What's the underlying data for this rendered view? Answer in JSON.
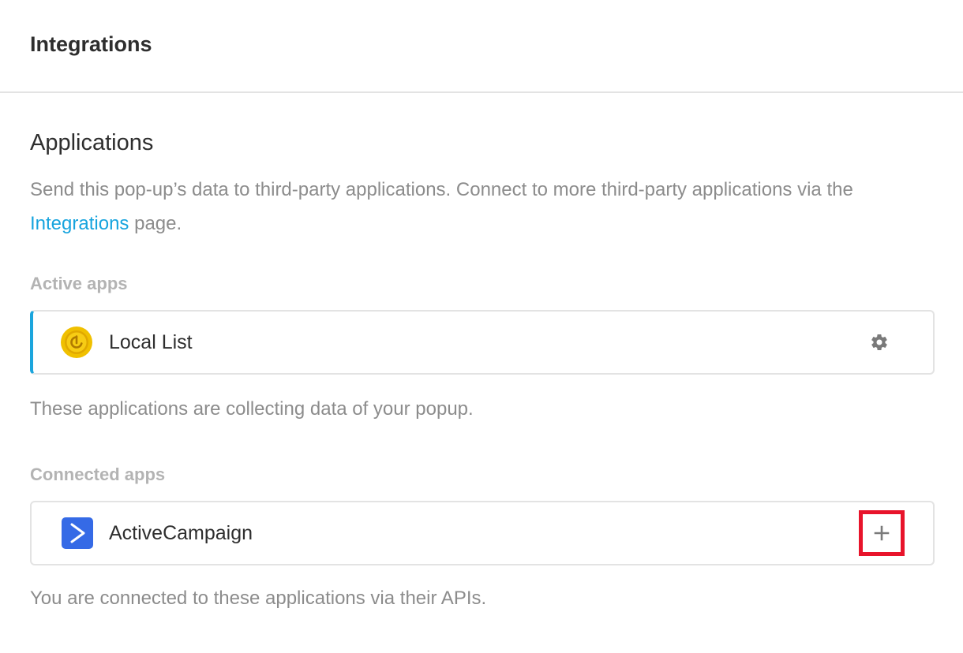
{
  "header": {
    "title": "Integrations"
  },
  "applications": {
    "title": "Applications",
    "description_prefix": "Send this pop-up’s data to third-party applications. Connect to more third-party applications via the",
    "description_link": "Integrations",
    "description_suffix": "page."
  },
  "active_apps": {
    "label": "Active apps",
    "items": [
      {
        "name": "Local List",
        "icon": "local-list-icon",
        "action_icon": "gear-icon",
        "icon_color": "#f5c400"
      }
    ],
    "helper": "These applications are collecting data of your popup."
  },
  "connected_apps": {
    "label": "Connected apps",
    "items": [
      {
        "name": "ActiveCampaign",
        "icon": "activecampaign-icon",
        "action_icon": "plus-icon",
        "icon_color": "#356ae6"
      }
    ],
    "helper": "You are connected to these applications via their APIs."
  },
  "colors": {
    "accent": "#1ba5dd",
    "link": "#17a4de",
    "highlight": "#e8142b"
  }
}
